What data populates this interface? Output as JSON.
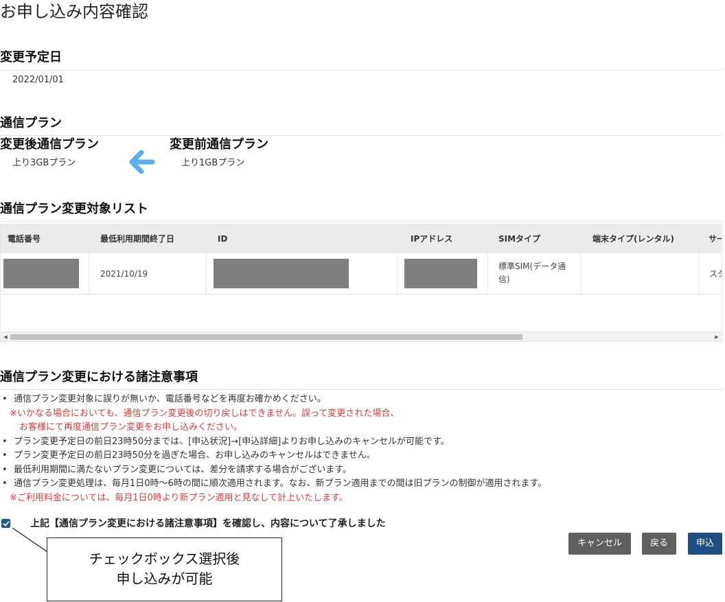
{
  "page": {
    "title": "お申し込み内容確認"
  },
  "change_date": {
    "heading": "変更予定日",
    "value": "2022/01/01"
  },
  "plan": {
    "heading": "通信プラン",
    "after_heading": "変更後通信プラン",
    "after_value": "上り3GBプラン",
    "before_heading": "変更前通信プラン",
    "before_value": "上り1GBプラン",
    "arrow_icon": "arrow-left-icon",
    "arrow_color": "#5aaef0"
  },
  "target_list": {
    "heading": "通信プラン変更対象リスト",
    "columns": [
      "電話番号",
      "最低利用期間終了日",
      "ID",
      "IPアドレス",
      "SIMタイプ",
      "端末タイプ(レンタル)",
      "サー"
    ],
    "rows": [
      {
        "phone": "",
        "min_period_end": "2021/10/19",
        "id": "",
        "ip": "",
        "sim_line1": "標準SIM(データ通",
        "sim_line2": "信)",
        "device": "",
        "service": "スタ"
      }
    ]
  },
  "notes": {
    "heading": "通信プラン変更における諸注意事項",
    "items": [
      "通信プラン変更対象に誤りが無いか、電話番号などを再度お確かめください。",
      "※いかなる場合においても、通信プラン変更後の切り戻しはできません。誤って変更された場合、",
      "お客様にて再度通信プラン変更をお申し込みください。",
      "プラン変更予定日の前日23時50分までは、[申込状況]→[申込詳細]よりお申し込みのキャンセルが可能です。",
      "プラン変更予定日の前日23時50分を過ぎた場合、お申し込みのキャンセルはできません。",
      "最低利用期間に満たないプラン変更については、差分を請求する場合がございます。",
      "通信プラン変更処理は、毎月1日0時～6時の間に順次適用されます。なお、新プラン適用までの間は旧プランの制御が適用されます。",
      "※ご利用料金については、毎月1日0時より新プラン適用と見なして計上いたします。"
    ],
    "bullet": "•",
    "red_color": "#e03c3c"
  },
  "agreement": {
    "label": "上記【通信プラン変更における諸注意事項】を確認し、内容について了承しました",
    "checked": true
  },
  "buttons": {
    "cancel": "キャンセル",
    "back": "戻る",
    "apply": "申込"
  },
  "callout": {
    "line1": "チェックボックス選択後",
    "line2": "申し込みが可能"
  }
}
